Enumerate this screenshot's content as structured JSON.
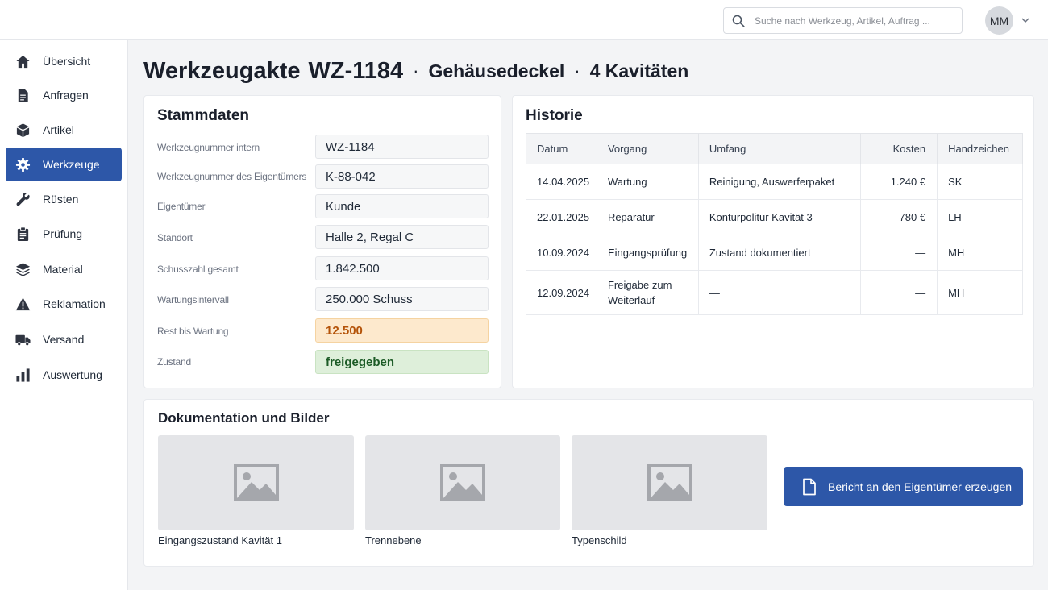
{
  "search": {
    "placeholder": "Suche nach Werkzeug, Artikel, Auftrag ..."
  },
  "user": {
    "initials": "MM"
  },
  "sidebar": {
    "items": [
      {
        "label": "Übersicht",
        "icon": "home-icon"
      },
      {
        "label": "Anfragen",
        "icon": "document-icon"
      },
      {
        "label": "Artikel",
        "icon": "box-icon"
      },
      {
        "label": "Werkzeuge",
        "icon": "gear-icon",
        "active": true
      },
      {
        "label": "Rüsten",
        "icon": "wrench-icon"
      },
      {
        "label": "Prüfung",
        "icon": "clipboard-icon"
      },
      {
        "label": "Material",
        "icon": "layers-icon"
      },
      {
        "label": "Reklamation",
        "icon": "warning-icon"
      },
      {
        "label": "Versand",
        "icon": "truck-icon"
      },
      {
        "label": "Auswertung",
        "icon": "bar-chart-icon"
      }
    ]
  },
  "page": {
    "title": "Werkzeugakte",
    "tool_id": "WZ-1184",
    "separator": "·",
    "part_name": "Gehäusedeckel",
    "cavities": "4 Kavitäten"
  },
  "stammdaten": {
    "title": "Stammdaten",
    "fields": [
      {
        "label": "Werkzeugnummer intern",
        "value": "WZ-1184"
      },
      {
        "label": "Werkzeugnummer des Eigentümers",
        "value": "K-88-042"
      },
      {
        "label": "Eigentümer",
        "value": "Kunde"
      },
      {
        "label": "Standort",
        "value": "Halle 2, Regal C"
      },
      {
        "label": "Schusszahl gesamt",
        "value": "1.842.500"
      },
      {
        "label": "Wartungsintervall",
        "value": "250.000 Schuss"
      },
      {
        "label": "Rest bis Wartung",
        "value": "12.500",
        "status": "warn"
      },
      {
        "label": "Zustand",
        "value": "freigegeben",
        "status": "ok"
      }
    ]
  },
  "historie": {
    "title": "Historie",
    "columns": [
      "Datum",
      "Vorgang",
      "Umfang",
      "Kosten",
      "Handzeichen"
    ],
    "rows": [
      [
        "14.04.2025",
        "Wartung",
        "Reinigung, Auswerferpaket",
        "1.240 €",
        "SK"
      ],
      [
        "22.01.2025",
        "Reparatur",
        "Konturpolitur Kavität 3",
        "780 €",
        "LH"
      ],
      [
        "10.09.2024",
        "Eingangsprüfung",
        "Zustand dokumentiert",
        "—",
        "MH"
      ],
      [
        "12.09.2024",
        "Freigabe zum Weiterlauf",
        "—",
        "—",
        "MH"
      ]
    ]
  },
  "dokumentation": {
    "title": "Dokumentation und Bilder",
    "images": [
      {
        "caption": "Eingangszustand Kavität 1"
      },
      {
        "caption": "Trennebene"
      },
      {
        "caption": "Typenschild"
      }
    ],
    "report_button": "Bericht an den Eigentümer erzeugen"
  },
  "colors": {
    "accent": "#2d57a8",
    "warn_bg": "#fde9cd",
    "warn_text": "#b45309",
    "ok_bg": "#deefda",
    "ok_text": "#1c5b26"
  }
}
